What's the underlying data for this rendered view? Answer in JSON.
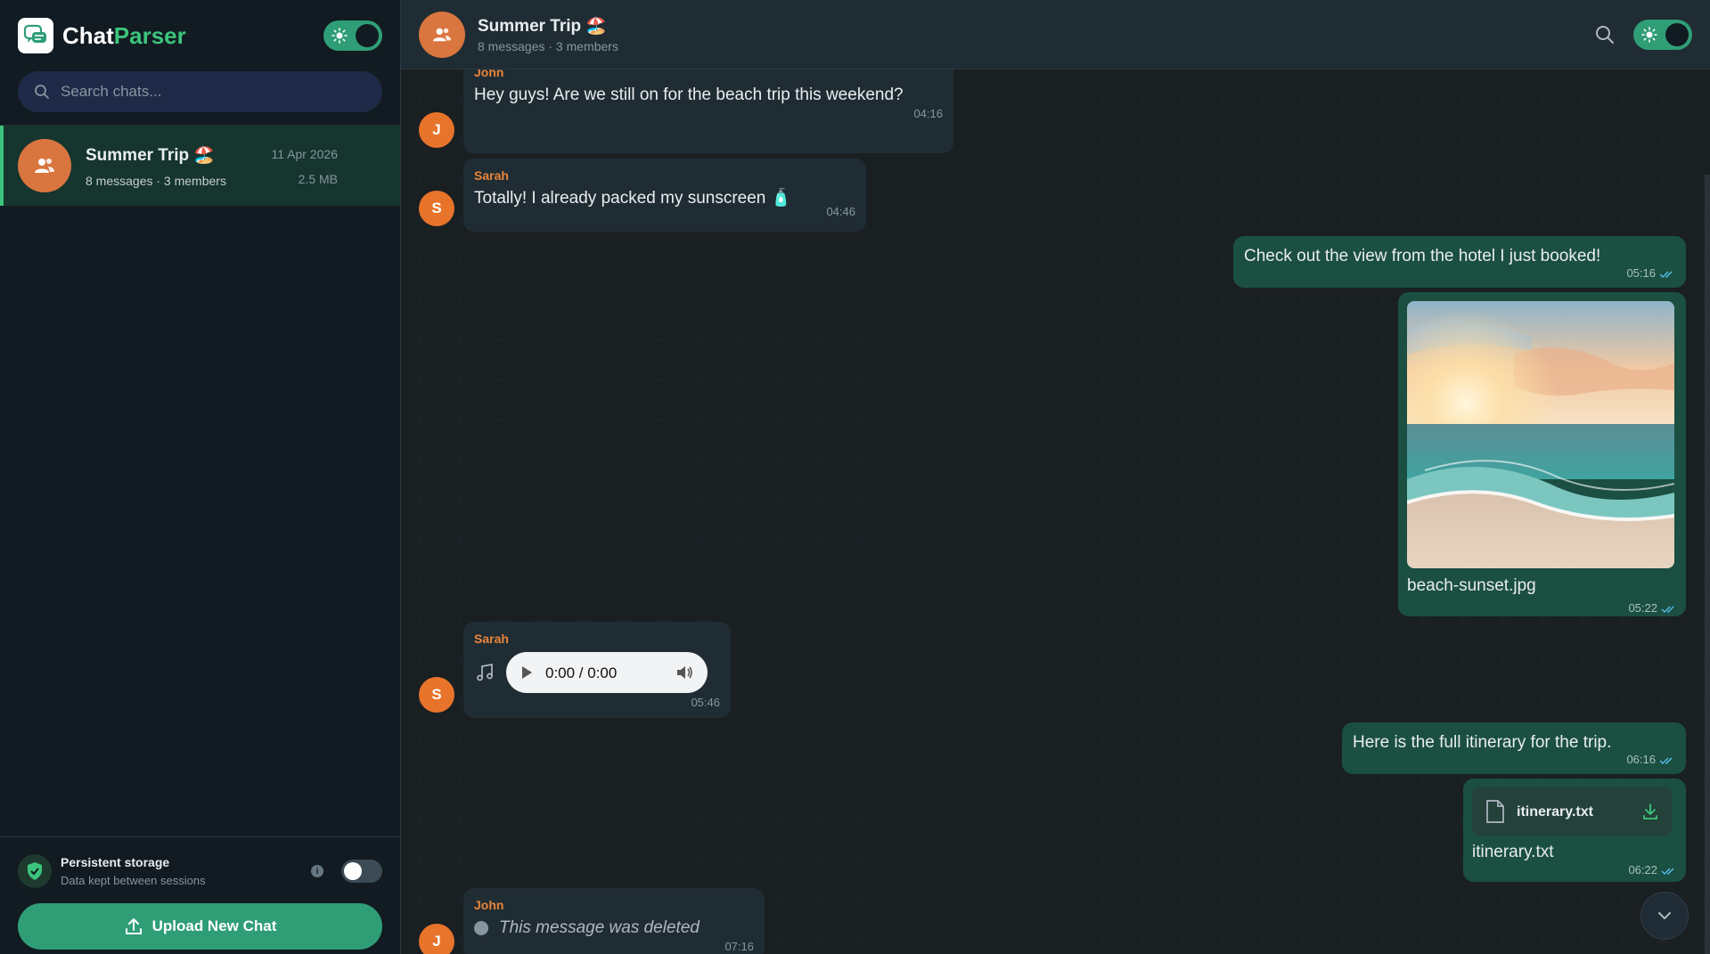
{
  "brand": {
    "part1": "Chat",
    "part2": "Parser"
  },
  "search": {
    "placeholder": "Search chats..."
  },
  "chat_list": [
    {
      "title": "Summer Trip 🏖️",
      "subtitle": "8 messages · 3 members",
      "date": "11 Apr 2026",
      "size": "2.5 MB"
    }
  ],
  "footer": {
    "storage_title": "Persistent storage",
    "storage_sub": "Data kept between sessions",
    "info": "i",
    "upload_label": "Upload New Chat"
  },
  "header": {
    "title": "Summer Trip 🏖️",
    "subtitle": "8 messages · 3 members"
  },
  "messages": [
    {
      "sender": "John",
      "initial": "J",
      "text": "Hey guys! Are we still on for the beach trip this weekend?",
      "time": "04:16"
    },
    {
      "sender": "Sarah",
      "initial": "S",
      "text": "Totally! I already packed my sunscreen 🧴",
      "time": "04:46"
    },
    {
      "text": "Check out the view from the hotel I just booked!",
      "time": "05:16"
    },
    {
      "caption": "beach-sunset.jpg",
      "time": "05:22"
    },
    {
      "sender": "Sarah",
      "initial": "S",
      "audio_time": "0:00 / 0:00",
      "time": "05:46"
    },
    {
      "text": "Here is the full itinerary for the trip.",
      "time": "06:16"
    },
    {
      "file_name": "itinerary.txt",
      "caption": "itinerary.txt",
      "time": "06:22"
    },
    {
      "sender": "John",
      "initial": "J",
      "text": "This message was deleted",
      "time": "07:16"
    }
  ],
  "colors": {
    "accent": "#2f9e76",
    "outgoing": "#1b4f41",
    "incoming": "#202c33",
    "sender": "#e8843a",
    "avatar": "#e8732a"
  },
  "icons": [
    "search-icon",
    "sun-icon",
    "group-icon",
    "shield-icon",
    "upload-icon",
    "music-icon",
    "play-icon",
    "volume-icon",
    "file-icon",
    "download-icon",
    "double-check-icon",
    "chevron-down-icon"
  ]
}
